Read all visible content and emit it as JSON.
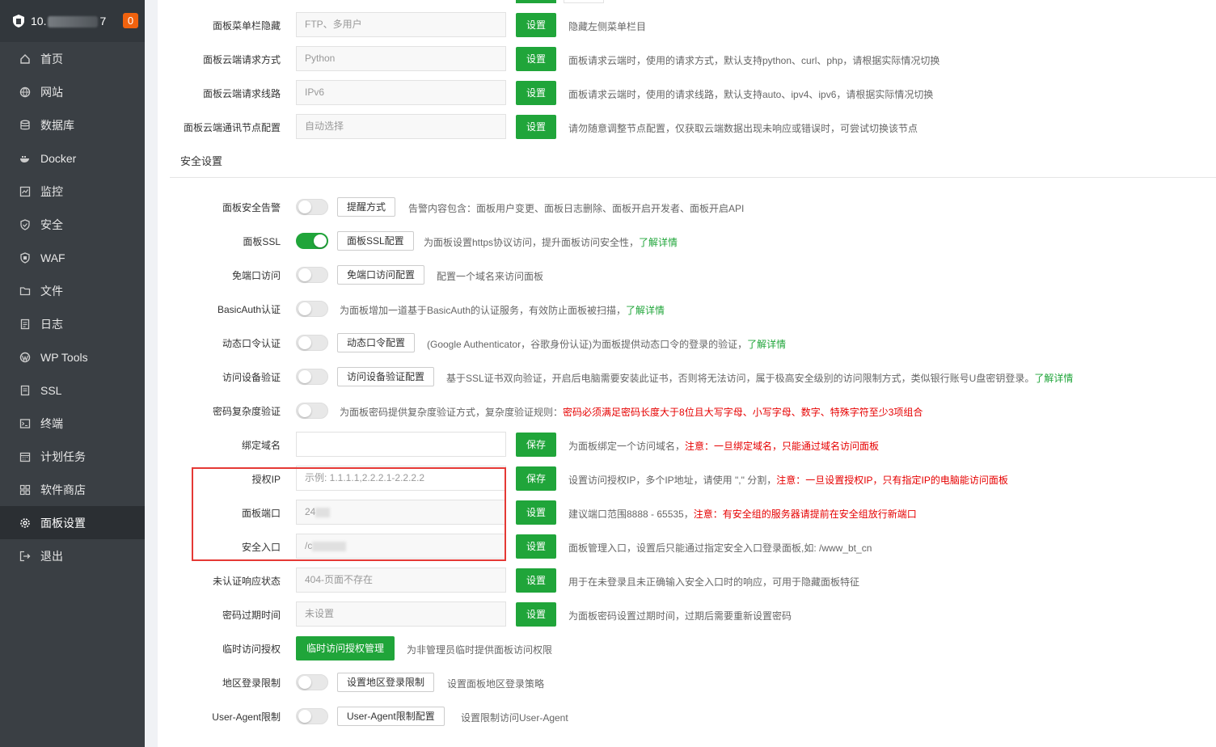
{
  "sidebar": {
    "host_prefix": "10.",
    "host_suffix": "7",
    "badge": "0",
    "items": [
      {
        "label": "首页",
        "icon": "home-icon"
      },
      {
        "label": "网站",
        "icon": "globe-icon"
      },
      {
        "label": "数据库",
        "icon": "database-icon"
      },
      {
        "label": "Docker",
        "icon": "docker-icon"
      },
      {
        "label": "监控",
        "icon": "monitor-icon"
      },
      {
        "label": "安全",
        "icon": "shield-icon"
      },
      {
        "label": "WAF",
        "icon": "waf-shield-icon"
      },
      {
        "label": "文件",
        "icon": "folder-icon"
      },
      {
        "label": "日志",
        "icon": "log-icon"
      },
      {
        "label": "WP Tools",
        "icon": "wordpress-icon"
      },
      {
        "label": "SSL",
        "icon": "ssl-icon"
      },
      {
        "label": "终端",
        "icon": "terminal-icon"
      },
      {
        "label": "计划任务",
        "icon": "calendar-icon"
      },
      {
        "label": "软件商店",
        "icon": "apps-icon"
      },
      {
        "label": "面板设置",
        "icon": "gear-icon"
      },
      {
        "label": "退出",
        "icon": "logout-icon"
      }
    ],
    "active_index": 14
  },
  "top_rows": [
    {
      "label": "面板菜单栏隐藏",
      "placeholder": "FTP、多用户",
      "button": "设置",
      "desc": "隐藏左侧菜单栏目"
    },
    {
      "label": "面板云端请求方式",
      "placeholder": "Python",
      "button": "设置",
      "desc": "面板请求云端时，使用的请求方式，默认支持python、curl、php，请根据实际情况切换"
    },
    {
      "label": "面板云端请求线路",
      "placeholder": "IPv6",
      "button": "设置",
      "desc": "面板请求云端时，使用的请求线路，默认支持auto、ipv4、ipv6，请根据实际情况切换"
    },
    {
      "label": "面板云端通讯节点配置",
      "placeholder": "自动选择",
      "button": "设置",
      "desc": "请勿随意调整节点配置，仅获取云端数据出现未响应或错误时，可尝试切换该节点"
    }
  ],
  "security_title": "安全设置",
  "toggles": {
    "alarm": {
      "label": "面板安全告警",
      "button": "提醒方式",
      "desc": "告警内容包含：面板用户变更、面板日志删除、面板开启开发者、面板开启API"
    },
    "ssl": {
      "label": "面板SSL",
      "button": "面板SSL配置",
      "desc": "为面板设置https协议访问，提升面板访问安全性，",
      "link": "了解详情"
    },
    "noport": {
      "label": "免端口访问",
      "button": "免端口访问配置",
      "desc": "配置一个域名来访问面板"
    },
    "basicauth": {
      "label": "BasicAuth认证",
      "desc": "为面板增加一道基于BasicAuth的认证服务，有效防止面板被扫描，",
      "link": "了解详情"
    },
    "totp": {
      "label": "动态口令认证",
      "button": "动态口令配置",
      "desc": "(Google Authenticator，谷歌身份认证)为面板提供动态口令的登录的验证，",
      "link": "了解详情"
    },
    "device": {
      "label": "访问设备验证",
      "button": "访问设备验证配置",
      "desc": "基于SSL证书双向验证，开启后电脑需要安装此证书，否则将无法访问，属于极高安全级别的访问限制方式，类似银行账号U盘密钥登录。",
      "link": "了解详情"
    },
    "pwcomplex": {
      "label": "密码复杂度验证",
      "desc": "为面板密码提供复杂度验证方式，复杂度验证规则：",
      "red": "密码必须满足密码长度大于8位且大写字母、小写字母、数字、特殊字符至少3项组合"
    }
  },
  "domain": {
    "label": "绑定域名",
    "button": "保存",
    "desc": "为面板绑定一个访问域名，",
    "red": "注意：一旦绑定域名，只能通过域名访问面板"
  },
  "auth_ip": {
    "label": "授权IP",
    "placeholder": "示例: 1.1.1.1,2.2.2.1-2.2.2.2",
    "button": "保存",
    "desc": "设置访问授权IP，多个IP地址，请使用 \",\" 分割，",
    "red": "注意：一旦设置授权IP，只有指定IP的电脑能访问面板"
  },
  "port": {
    "label": "面板端口",
    "value": "24",
    "button": "设置",
    "desc": "建议端口范围8888 - 65535，",
    "red": "注意：有安全组的服务器请提前在安全组放行新端口"
  },
  "entry": {
    "label": "安全入口",
    "value": "/c",
    "button": "设置",
    "desc": "面板管理入口，设置后只能通过指定安全入口登录面板,如: /www_bt_cn"
  },
  "unauth": {
    "label": "未认证响应状态",
    "placeholder": "404-页面不存在",
    "button": "设置",
    "desc": "用于在未登录且未正确输入安全入口时的响应，可用于隐藏面板特征"
  },
  "pwexpire": {
    "label": "密码过期时间",
    "placeholder": "未设置",
    "button": "设置",
    "desc": "为面板密码设置过期时间，过期后需要重新设置密码"
  },
  "tempauth": {
    "label": "临时访问授权",
    "button": "临时访问授权管理",
    "desc": "为非管理员临时提供面板访问权限"
  },
  "region": {
    "label": "地区登录限制",
    "button": "设置地区登录限制",
    "desc": "设置面板地区登录策略"
  },
  "ua": {
    "label": "User-Agent限制",
    "button": "User-Agent限制配置",
    "desc": "设置限制访问User-Agent"
  }
}
